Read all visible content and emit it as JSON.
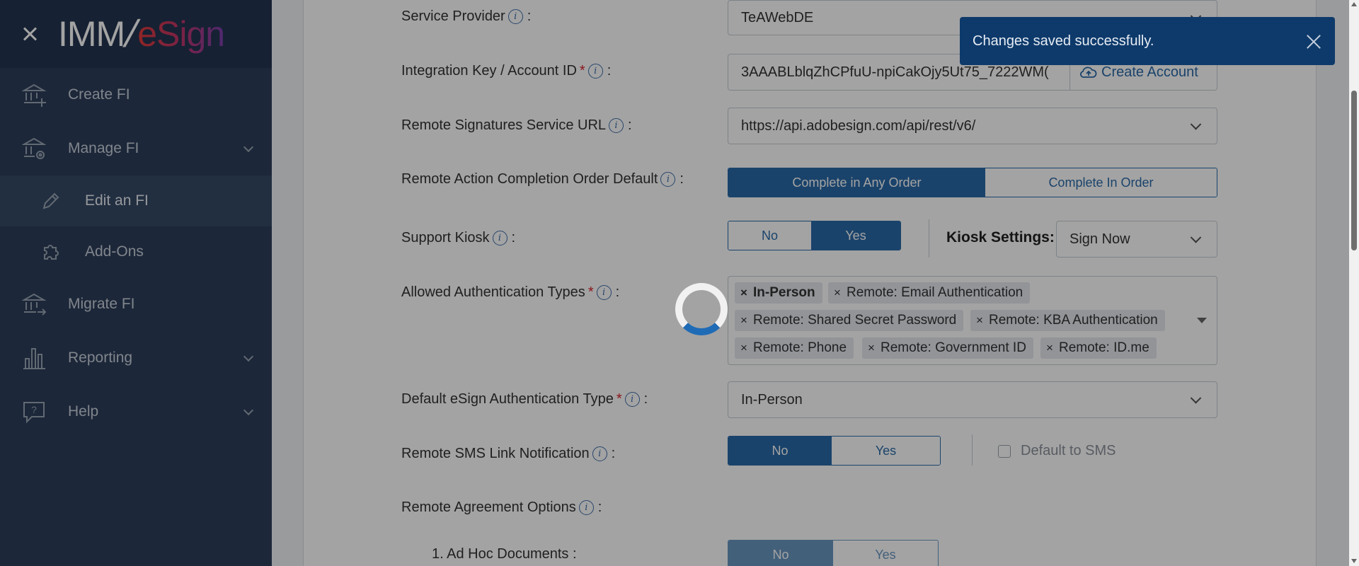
{
  "sidebar": {
    "logo_left": "IMM",
    "logo_right": "eSign",
    "items": [
      {
        "label": "Create FI",
        "icon": "bank-plus-icon"
      },
      {
        "label": "Manage FI",
        "icon": "bank-gear-icon"
      },
      {
        "label": "Edit an FI",
        "icon": "pencil-icon"
      },
      {
        "label": "Add-Ons",
        "icon": "puzzle-icon"
      },
      {
        "label": "Migrate FI",
        "icon": "bank-arrow-icon"
      },
      {
        "label": "Reporting",
        "icon": "bar-chart-icon"
      },
      {
        "label": "Help",
        "icon": "help-bubble-icon"
      }
    ]
  },
  "form": {
    "service_provider": {
      "label": "Service Provider",
      "value": "TeAWebDE"
    },
    "integration_key": {
      "label": "Integration Key / Account ID",
      "value": "3AAABLblqZhCPfuU-npiCakOjy5Ut75_7222WM(",
      "create_account": "Create Account"
    },
    "remote_url": {
      "label": "Remote Signatures Service URL",
      "value": "https://api.adobesign.com/api/rest/v6/"
    },
    "completion_order": {
      "label": "Remote Action Completion Order Default",
      "option_a": "Complete in Any Order",
      "option_b": "Complete In Order",
      "selected": "Complete in Any Order"
    },
    "support_kiosk": {
      "label": "Support Kiosk",
      "no": "No",
      "yes": "Yes",
      "selected": "Yes",
      "kiosk_settings_label": "Kiosk Settings:",
      "kiosk_settings_value": "Sign Now"
    },
    "auth_types": {
      "label": "Allowed Authentication Types",
      "tags": [
        "In-Person",
        "Remote: Email Authentication",
        "Remote: Shared Secret Password",
        "Remote: KBA Authentication",
        "Remote: Phone",
        "Remote: Government ID",
        "Remote: ID.me"
      ]
    },
    "default_auth": {
      "label": "Default eSign Authentication Type",
      "value": "In-Person"
    },
    "sms_link": {
      "label": "Remote SMS Link Notification",
      "no": "No",
      "yes": "Yes",
      "selected": "No",
      "default_sms": "Default to SMS"
    },
    "agreement_options": {
      "label": "Remote Agreement Options"
    },
    "ad_hoc": {
      "label": "1. Ad Hoc Documents :",
      "no": "No",
      "yes": "Yes",
      "selected": "No"
    }
  },
  "colon": ":",
  "info_glyph": "i",
  "required_glyph": "*",
  "tag_remove": "×",
  "toast": {
    "message": "Changes saved successfully."
  },
  "colors": {
    "primary": "#2a6aa8",
    "sidebar": "#2c3e5a",
    "toast": "#0e3a6b",
    "required": "#d9232e"
  }
}
